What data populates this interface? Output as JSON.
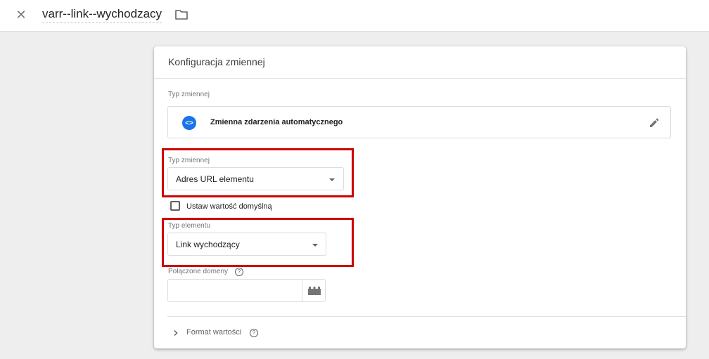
{
  "header": {
    "title": "varr--link--wychodzacy",
    "close_icon": "close-icon",
    "folder_icon": "folder-icon"
  },
  "card": {
    "title": "Konfiguracja zmiennej",
    "variable_type_section_label": "Typ zmiennej",
    "variable_type_name": "Zmienna zdarzenia automatycznego",
    "variable_type_icon": "code-brackets-icon",
    "edit_icon": "pencil-icon",
    "variable_type_field": {
      "label": "Typ zmiennej",
      "value": "Adres URL elementu"
    },
    "default_value_checkbox": {
      "label": "Ustaw wartość domyślną",
      "checked": false
    },
    "element_type_field": {
      "label": "Typ elementu",
      "value": "Link wychodzący"
    },
    "linked_domains": {
      "label": "Połączone domeny",
      "value": "",
      "help_icon": "help-circle-icon",
      "variable_button_icon": "lego-brick-icon"
    },
    "format_value": {
      "label": "Format wartości",
      "expanded": false,
      "help_icon": "help-circle-icon"
    }
  },
  "colors": {
    "highlight_red": "#cc0000",
    "accent_blue": "#1a73e8",
    "page_background": "#eeeeee"
  }
}
